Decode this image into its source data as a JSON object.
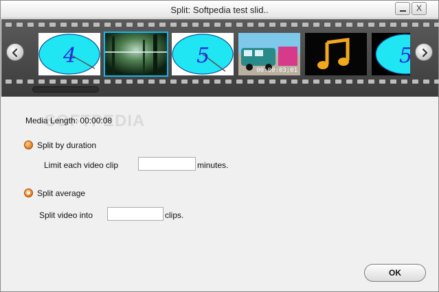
{
  "window": {
    "title": "Split: Softpedia test slid..",
    "minimize_label": "",
    "close_label": "X"
  },
  "filmstrip": {
    "thumbnails": [
      {
        "kind": "clock",
        "digit": "4"
      },
      {
        "kind": "image",
        "description_icon": "forest-photo"
      },
      {
        "kind": "clock",
        "digit": "5"
      },
      {
        "kind": "image",
        "description_icon": "vehicle-photo",
        "timecode": "00:00:03;01"
      },
      {
        "kind": "audio",
        "description_icon": "music-note-icon"
      },
      {
        "kind": "clock-partial",
        "digit": "5"
      }
    ]
  },
  "media": {
    "length_label": "Media Length: 00:00:08",
    "watermark": "SOFTPEDIA"
  },
  "options": {
    "split_by_duration_label": "Split by duration",
    "limit_prefix": "Limit each video clip",
    "limit_value": "",
    "limit_suffix": "minutes.",
    "split_average_label": "Split average",
    "split_into_prefix": "Split video into",
    "split_into_value": "",
    "split_into_suffix": "clips."
  },
  "footer": {
    "ok_label": "OK"
  },
  "colors": {
    "accent": "#16b8ef",
    "radio": "#e6781a",
    "filmstrip": "#4a4a4a"
  }
}
